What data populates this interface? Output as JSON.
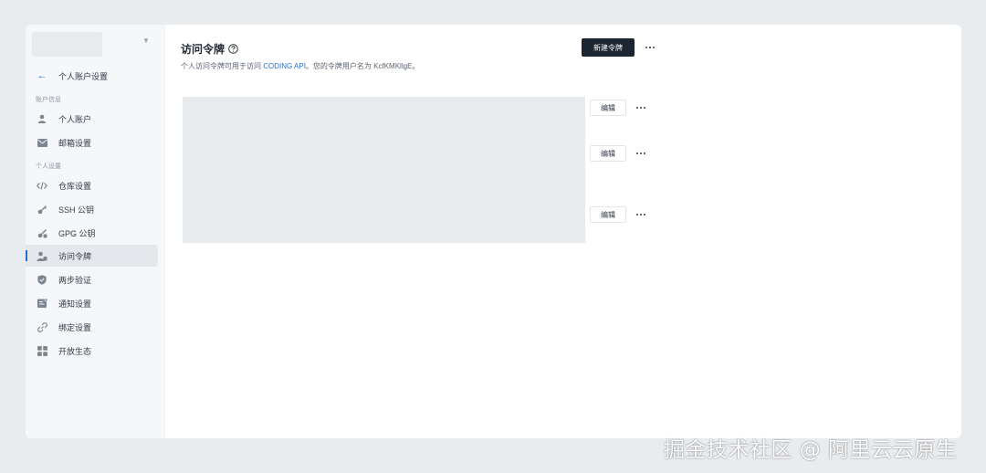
{
  "sidebar": {
    "back_label": "个人账户设置",
    "groups": [
      {
        "label": "账户信息"
      },
      {
        "label": "个人设置"
      }
    ],
    "items": [
      {
        "label": "个人账户",
        "icon": "user-icon"
      },
      {
        "label": "邮箱设置",
        "icon": "mail-icon"
      },
      {
        "label": "仓库设置",
        "icon": "code-icon"
      },
      {
        "label": "SSH 公钥",
        "icon": "key-icon"
      },
      {
        "label": "GPG 公钥",
        "icon": "gpg-key-icon"
      },
      {
        "label": "访问令牌",
        "icon": "user-token-icon",
        "active": true
      },
      {
        "label": "两步验证",
        "icon": "shield-icon"
      },
      {
        "label": "通知设置",
        "icon": "notification-icon"
      },
      {
        "label": "绑定设置",
        "icon": "link-icon"
      },
      {
        "label": "开放生态",
        "icon": "apps-icon"
      }
    ]
  },
  "main": {
    "title": "访问令牌",
    "subtitle_prefix": "个人访问令牌可用于访问 ",
    "subtitle_link": "CODING API",
    "subtitle_suffix": "。您的令牌用户名为 KcfKMKllgE。",
    "new_button": "新建令牌",
    "tokens": [
      {
        "edit_label": "编辑"
      },
      {
        "edit_label": "编辑"
      },
      {
        "edit_label": "编辑"
      }
    ]
  },
  "watermark": "掘金技术社区 @ 阿里云云原生",
  "colors": {
    "accent": "#1e6fd9",
    "primary_button": "#1c2633",
    "sidebar_bg": "#f5f7fa",
    "page_bg": "#e9ecef"
  }
}
